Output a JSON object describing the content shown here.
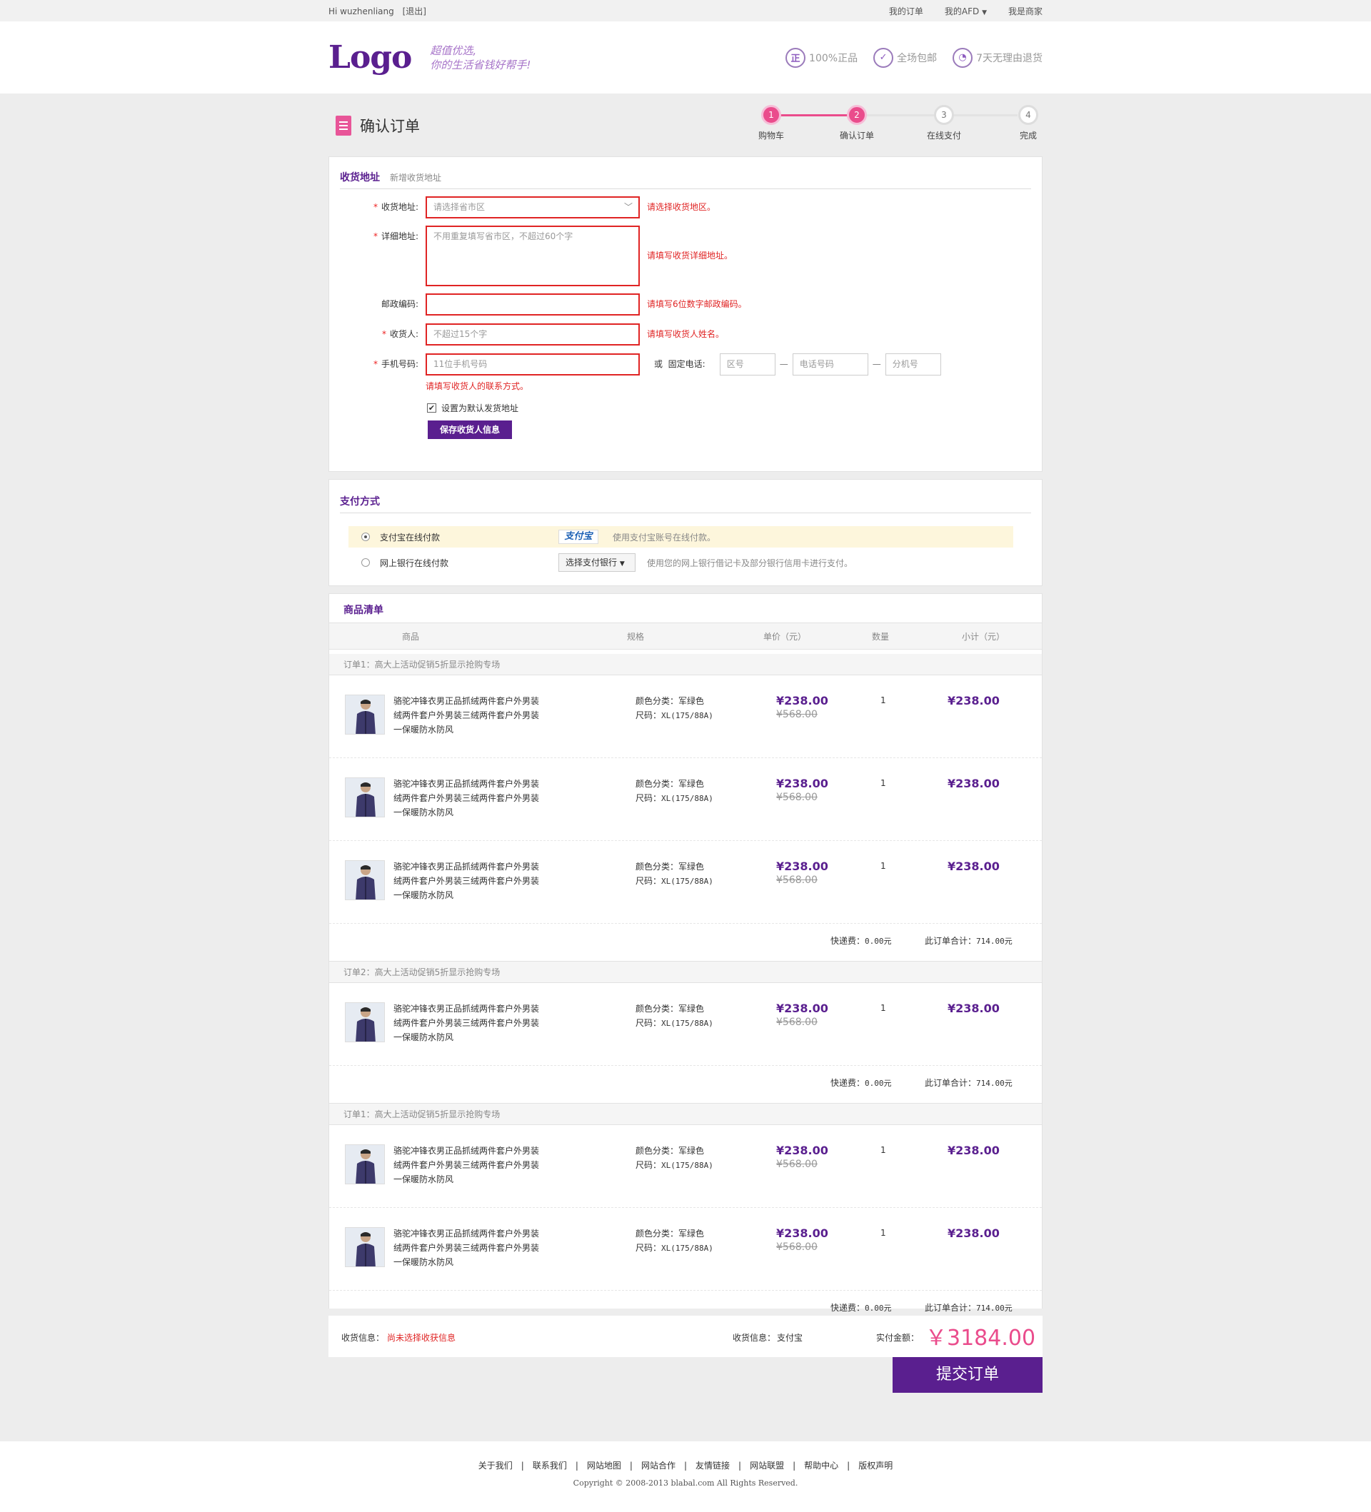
{
  "topbar": {
    "greeting": "Hi wuzhenliang",
    "logout": "[退出]",
    "my_orders": "我的订单",
    "my_afd": "我的AFD",
    "merchant": "我是商家"
  },
  "header": {
    "logo": "Logo",
    "slogan_line1": "超值优选,",
    "slogan_line2": "你的生活省钱好帮手!",
    "badges": [
      {
        "icon": "正",
        "label": "100%正品"
      },
      {
        "icon": "✓",
        "label": "全场包邮"
      },
      {
        "icon": "◔",
        "label": "7天无理由退货"
      }
    ]
  },
  "title": "确认订单",
  "steps": [
    {
      "num": "1",
      "label": "购物车"
    },
    {
      "num": "2",
      "label": "确认订单"
    },
    {
      "num": "3",
      "label": "在线支付"
    },
    {
      "num": "4",
      "label": "完成"
    }
  ],
  "address": {
    "title": "收货地址",
    "new_link": "新增收货地址",
    "region_label": "收货地址:",
    "region_placeholder": "请选择省市区",
    "region_error": "请选择收货地区。",
    "detail_label": "详细地址:",
    "detail_placeholder": "不用重复填写省市区，不超过60个字",
    "detail_error": "请填写收货详细地址。",
    "zip_label": "邮政编码:",
    "zip_value": "",
    "zip_error": "请填写6位数字邮政编码。",
    "name_label": "收货人:",
    "name_placeholder": "不超过15个字",
    "name_error": "请填写收货人姓名。",
    "phone_label": "手机号码:",
    "phone_placeholder": "11位手机号码",
    "phone_error": "请填写收货人的联系方式。",
    "or_label": "或  固定电话:",
    "area_placeholder": "区号",
    "tel_placeholder": "电话号码",
    "ext_placeholder": "分机号",
    "default_label": "设置为默认发货地址",
    "save_button": "保存收货人信息"
  },
  "payment": {
    "title": "支付方式",
    "options": [
      {
        "label": "支付宝在线付款",
        "logo": "支付宝",
        "desc": "使用支付宝账号在线付款。"
      },
      {
        "label": "网上银行在线付款",
        "select": "选择支付银行",
        "desc": "使用您的网上银行借记卡及部分银行信用卡进行支付。"
      }
    ]
  },
  "goods": {
    "title": "商品清单",
    "headers": [
      "商品",
      "规格",
      "单价（元）",
      "数量",
      "小计（元）"
    ],
    "item": {
      "line1": "骆驼冲锋衣男正品抓绒两件套户外男装",
      "line2": "绒两件套户外男装三绒两件套户外男装",
      "line3": "一保暖防水防风",
      "color_label": "颜色分类：",
      "color": "军绿色",
      "size_label": "尺码：",
      "size": "XL(175/88A)",
      "price": "¥238.00",
      "orig": "¥568.00",
      "qty": "1",
      "subtotal": "¥238.00"
    },
    "orders": [
      {
        "title": "订单1：高大上活动促销5折显示抢购专场",
        "ship_label": "快递费：",
        "ship": "0.00元",
        "total_label": "此订单合计：",
        "total": "714.00元"
      },
      {
        "title": "订单2：高大上活动促销5折显示抢购专场",
        "ship_label": "快递费：",
        "ship": "0.00元",
        "total_label": "此订单合计：",
        "total": "714.00元"
      },
      {
        "title": "订单1：高大上活动促销5折显示抢购专场",
        "ship_label": "快递费：",
        "ship": "0.00元",
        "total_label": "此订单合计：",
        "total": "714.00元"
      }
    ]
  },
  "summary": {
    "addr_label": "收货信息：",
    "addr_value": "尚未选择收获信息",
    "pay_label": "收货信息：",
    "pay_value": "支付宝",
    "amount_label": "实付金额：",
    "amount": "￥3184.00",
    "submit": "提交订单"
  },
  "footer": {
    "links": [
      "关于我们",
      "联系我们",
      "网站地图",
      "网站合作",
      "友情链接",
      "网站联盟",
      "帮助中心",
      "版权声明"
    ],
    "copyright": "Copyright © 2008-2013 blabal.com All Rights Reserved."
  },
  "colors": {
    "brand": "#5a1f8f",
    "accent": "#ea4c8c",
    "error": "#e02424",
    "highlight": "#fdf6dc"
  }
}
